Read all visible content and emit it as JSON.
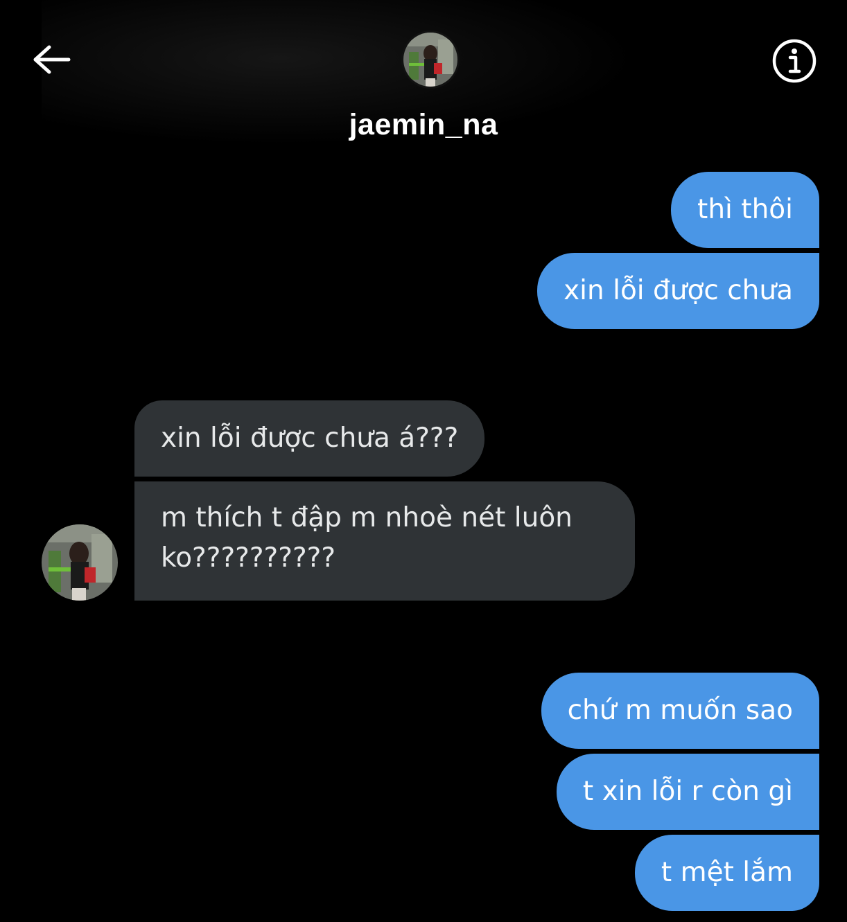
{
  "header": {
    "back_icon": "arrow-left-icon",
    "info_icon": "info-circle-icon",
    "username": "jaemin_na"
  },
  "messages": [
    {
      "direction": "outgoing",
      "text": "thì thôi"
    },
    {
      "direction": "outgoing",
      "text": "xin lỗi được chưa"
    },
    {
      "direction": "incoming",
      "text": "xin lỗi được chưa á???"
    },
    {
      "direction": "incoming",
      "lines": [
        "m thích t đập m nhoè nét luôn",
        "ko??????????"
      ]
    },
    {
      "direction": "outgoing",
      "text": "chứ m muốn sao"
    },
    {
      "direction": "outgoing",
      "text": "t xin lỗi r còn gì"
    },
    {
      "direction": "outgoing",
      "text": "t mệt lắm"
    }
  ],
  "colors": {
    "background": "#000000",
    "outgoing_bubble": "#4a96e6",
    "incoming_bubble": "#2f3336",
    "text": "#ffffff"
  }
}
